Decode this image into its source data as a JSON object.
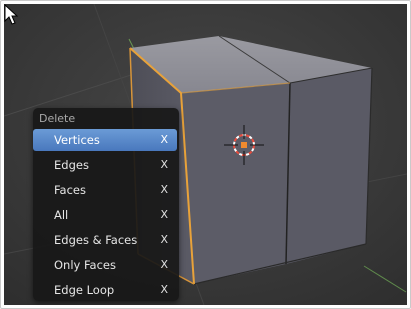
{
  "delete_menu": {
    "title": "Delete",
    "items": [
      {
        "label": "Vertices",
        "shortcut": "X",
        "active": true
      },
      {
        "label": "Edges",
        "shortcut": "X"
      },
      {
        "label": "Faces",
        "shortcut": "X"
      },
      {
        "label": "All",
        "shortcut": "X"
      },
      {
        "label": "Edges & Faces",
        "shortcut": "X"
      },
      {
        "label": "Only Faces",
        "shortcut": "X"
      },
      {
        "label": "Edge Loop",
        "shortcut": "X"
      }
    ]
  },
  "colors": {
    "viewport_background": "#3b3b3b",
    "selection_edge": "#e8a23a",
    "menu_highlight": "#5b8fd0",
    "cursor_3d": "#e84c3d"
  },
  "icons": [
    "3d-cursor-icon",
    "mouse-pointer-icon"
  ]
}
